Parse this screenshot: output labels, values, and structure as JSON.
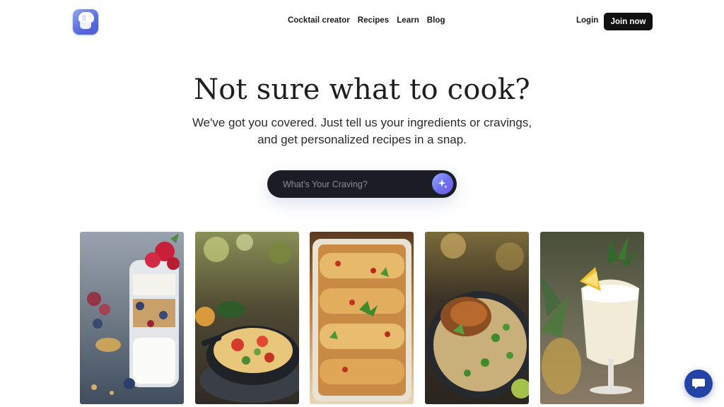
{
  "header": {
    "logo_icon": "chef-hat-icon",
    "nav": [
      {
        "label": "Cocktail creator"
      },
      {
        "label": "Recipes"
      },
      {
        "label": "Learn"
      },
      {
        "label": "Blog"
      }
    ],
    "login_label": "Login",
    "join_label": "Join now"
  },
  "hero": {
    "title": "Not sure what to cook?",
    "subtitle_line1": "We've got you covered. Just tell us your ingredients or cravings,",
    "subtitle_line2": "and get personalized recipes in a snap."
  },
  "search": {
    "placeholder": "What's Your Craving?",
    "value": "",
    "button_icon": "sparkle-icon",
    "accent": "#6a6ff0"
  },
  "gallery": [
    {
      "icon": "yogurt-parfait-photo"
    },
    {
      "icon": "skillet-frittata-photo"
    },
    {
      "icon": "enchiladas-photo"
    },
    {
      "icon": "chicken-orzo-photo"
    },
    {
      "icon": "pina-colada-photo"
    }
  ],
  "chat": {
    "icon": "chat-bubble-icon",
    "color": "#2343a6"
  }
}
